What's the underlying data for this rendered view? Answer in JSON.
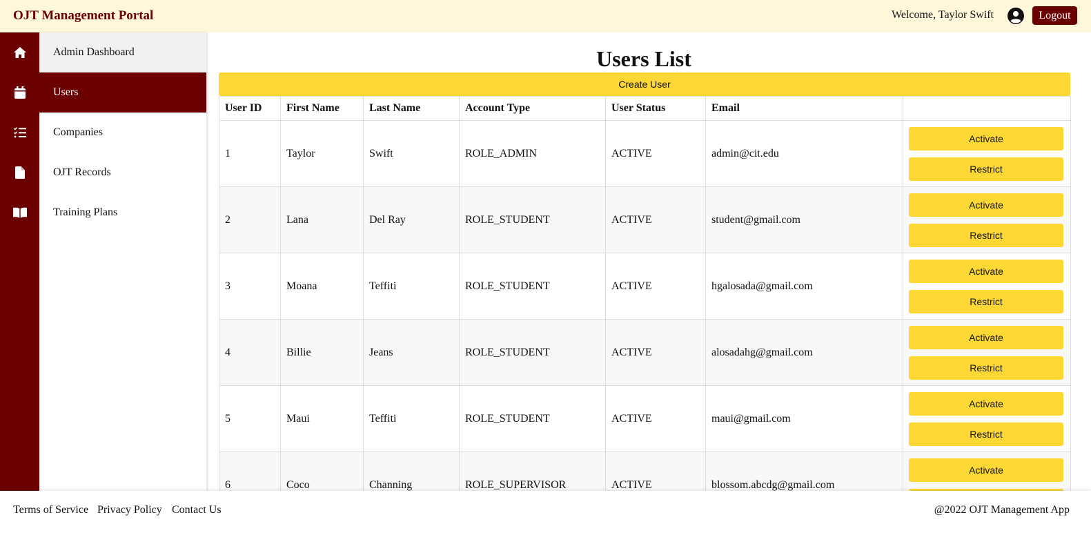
{
  "app": {
    "title": "OJT Management Portal"
  },
  "header": {
    "welcome": "Welcome, Taylor Swift",
    "logout_label": "Logout"
  },
  "sidebar": {
    "items": [
      {
        "label": "Admin Dashboard",
        "icon": "home-icon"
      },
      {
        "label": "Users",
        "icon": "calendar-icon"
      },
      {
        "label": "Companies",
        "icon": "task-list-icon"
      },
      {
        "label": "OJT Records",
        "icon": "file-icon"
      },
      {
        "label": "Training Plans",
        "icon": "book-icon"
      }
    ],
    "active": "Users"
  },
  "main": {
    "title": "Users List",
    "create_label": "Create User",
    "columns": [
      "User ID",
      "First Name",
      "Last Name",
      "Account Type",
      "User Status",
      "Email",
      ""
    ],
    "rows": [
      {
        "id": "1",
        "first": "Taylor",
        "last": "Swift",
        "type": "ROLE_ADMIN",
        "status": "ACTIVE",
        "email": "admin@cit.edu"
      },
      {
        "id": "2",
        "first": "Lana",
        "last": "Del Ray",
        "type": "ROLE_STUDENT",
        "status": "ACTIVE",
        "email": "student@gmail.com"
      },
      {
        "id": "3",
        "first": "Moana",
        "last": "Teffiti",
        "type": "ROLE_STUDENT",
        "status": "ACTIVE",
        "email": "hgalosada@gmail.com"
      },
      {
        "id": "4",
        "first": "Billie",
        "last": "Jeans",
        "type": "ROLE_STUDENT",
        "status": "ACTIVE",
        "email": "alosadahg@gmail.com"
      },
      {
        "id": "5",
        "first": "Maui",
        "last": "Teffiti",
        "type": "ROLE_STUDENT",
        "status": "ACTIVE",
        "email": "maui@gmail.com"
      },
      {
        "id": "6",
        "first": "Coco",
        "last": "Channing",
        "type": "ROLE_SUPERVISOR",
        "status": "ACTIVE",
        "email": "blossom.abcdg@gmail.com"
      }
    ],
    "activate_label": "Activate",
    "restrict_label": "Restrict"
  },
  "footer": {
    "links": [
      "Terms of Service",
      "Privacy Policy",
      "Contact Us"
    ],
    "copyright": "@2022 OJT Management App"
  },
  "colors": {
    "brand": "#6b0000",
    "accent": "#fdd835",
    "header_bg": "#fff7da"
  }
}
